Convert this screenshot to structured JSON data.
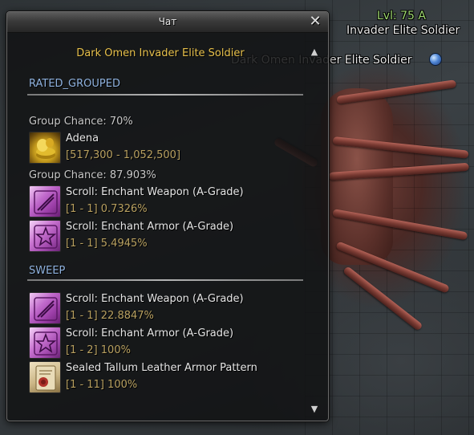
{
  "chat_window": {
    "title": "Чат",
    "npc_name": "Dark Omen Invader Elite Soldier",
    "sections": [
      {
        "title": "RATED_GROUPED",
        "groups": [
          {
            "chance_label": "Group Chance: 70%",
            "items": [
              {
                "name": "Adena",
                "detail": "[517,300 - 1,052,500]",
                "icon": "adena-icon"
              }
            ]
          },
          {
            "chance_label": "Group Chance: 87.903%",
            "items": [
              {
                "name": "Scroll: Enchant Weapon (A-Grade)",
                "detail": "[1 - 1] 0.7326%",
                "icon": "enchant-weapon-scroll-icon"
              },
              {
                "name": "Scroll: Enchant Armor (A-Grade)",
                "detail": "[1 - 1] 5.4945%",
                "icon": "enchant-armor-scroll-icon"
              }
            ]
          }
        ]
      },
      {
        "title": "SWEEP",
        "items": [
          {
            "name": "Scroll: Enchant Weapon (A-Grade)",
            "detail": "[1 - 1] 22.8847%",
            "icon": "enchant-weapon-scroll-icon"
          },
          {
            "name": "Scroll: Enchant Armor (A-Grade)",
            "detail": "[1 - 2] 100%",
            "icon": "enchant-armor-scroll-icon"
          },
          {
            "name": "Sealed Tallum Leather Armor Pattern",
            "detail": "[1 - 11] 100%",
            "icon": "recipe-pattern-icon"
          }
        ]
      }
    ]
  },
  "world": {
    "npc_labels": [
      "Lvl: 75 A",
      "Invader Elite Soldier",
      "Dark Omen Invader Elite Soldier"
    ]
  },
  "colors": {
    "section_title": "#8fb2df",
    "npc_name": "#e7c04b",
    "item_detail": "#b8a060",
    "level_text": "#9ed86f"
  }
}
